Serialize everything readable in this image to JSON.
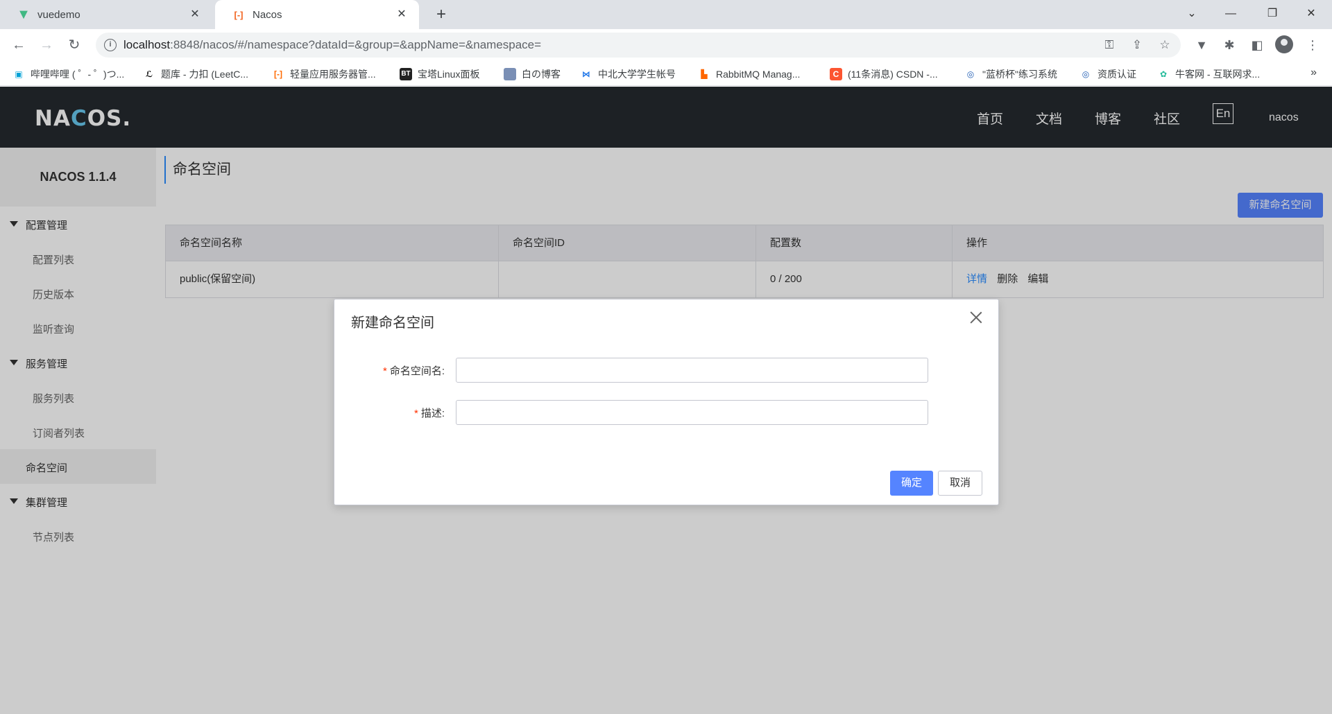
{
  "browser": {
    "tabs": [
      {
        "title": "vuedemo",
        "icon": "vue-icon"
      },
      {
        "title": "Nacos",
        "icon": "nacos-icon"
      }
    ],
    "url": {
      "host": "localhost",
      "path": ":8848/nacos/#/namespace?dataId=&group=&appName=&namespace="
    },
    "bookmarks": [
      {
        "label": "哔哩哔哩 ( ゜- ゜)つ...",
        "icon": "bilibili-icon",
        "color": "#00a1d6"
      },
      {
        "label": "题库 - 力扣 (LeetC...",
        "icon": "leetcode-icon",
        "color": "#000000"
      },
      {
        "label": "轻量应用服务器管...",
        "icon": "aliyun-icon",
        "color": "#ff6a00"
      },
      {
        "label": "宝塔Linux面板",
        "icon": "bt-icon",
        "color": "#20a53a"
      },
      {
        "label": "白の博客",
        "icon": "blog-icon",
        "color": "#4a6fa5"
      },
      {
        "label": "中北大学学生帐号",
        "icon": "nuc-icon",
        "color": "#1a73e8"
      },
      {
        "label": "RabbitMQ Manag...",
        "icon": "rabbitmq-icon",
        "color": "#ff6600"
      },
      {
        "label": "(11条消息) CSDN -...",
        "icon": "csdn-icon",
        "color": "#fc5531"
      },
      {
        "label": "\"蓝桥杯\"练习系统",
        "icon": "lanqiao-icon",
        "color": "#1e5cb3"
      },
      {
        "label": "资质认证",
        "icon": "lanqiao-icon",
        "color": "#1e5cb3"
      },
      {
        "label": "牛客网 - 互联网求...",
        "icon": "nowcoder-icon",
        "color": "#25bb9b"
      }
    ],
    "more": "»"
  },
  "nav": {
    "logo": "NACOS.",
    "items": [
      "首页",
      "文档",
      "博客",
      "社区"
    ],
    "lang": "En",
    "user": "nacos"
  },
  "sidebar": {
    "title": "NACOS 1.1.4",
    "groups": [
      {
        "label": "配置管理",
        "items": [
          "配置列表",
          "历史版本",
          "监听查询"
        ]
      },
      {
        "label": "服务管理",
        "items": [
          "服务列表",
          "订阅者列表"
        ]
      },
      {
        "label": "命名空间",
        "items": []
      },
      {
        "label": "集群管理",
        "items": [
          "节点列表"
        ]
      }
    ]
  },
  "main": {
    "title": "命名空间",
    "new_button": "新建命名空间",
    "table": {
      "columns": [
        "命名空间名称",
        "命名空间ID",
        "配置数",
        "操作"
      ],
      "rows": [
        {
          "name": "public(保留空间)",
          "id": "",
          "count": "0 / 200",
          "ops": [
            "详情",
            "删除",
            "编辑"
          ]
        }
      ]
    }
  },
  "dialog": {
    "title": "新建命名空间",
    "fields": [
      {
        "label": "命名空间名:",
        "value": "",
        "placeholder": ""
      },
      {
        "label": "描述:",
        "value": "",
        "placeholder": ""
      }
    ],
    "ok": "确定",
    "cancel": "取消"
  },
  "colors": {
    "primary": "#5584ff",
    "link": "#2a8cff",
    "header": "#252a2f",
    "required": "#ff3000"
  }
}
